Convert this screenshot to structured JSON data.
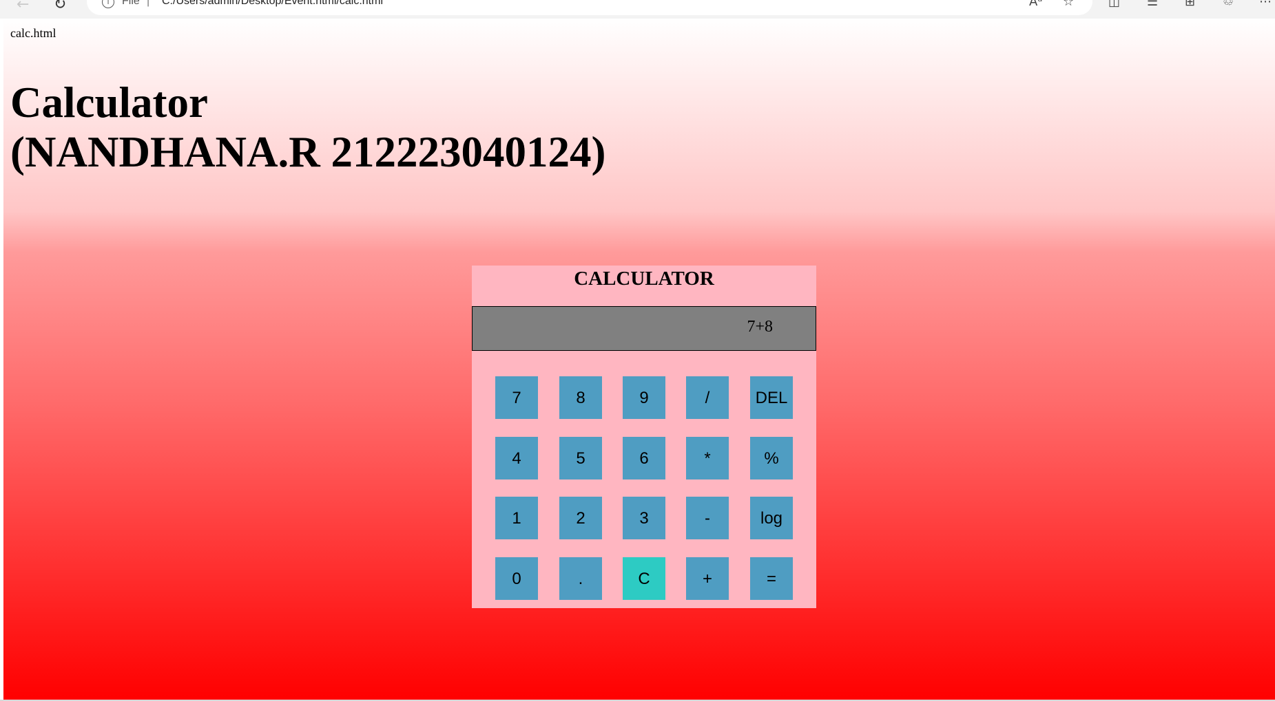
{
  "browser": {
    "back_glyph": "←",
    "reload_glyph": "↻",
    "info_glyph": "i",
    "scheme_label": "File",
    "separator": "|",
    "url": "C:/Users/admin/Desktop/Event.html/calc.html",
    "read_aloud_glyph": "Aᵃ",
    "favorite_glyph": "☆",
    "split_glyph": "◫",
    "favorites_list_glyph": "☰",
    "collections_glyph": "⊞",
    "extensions_glyph": "♲",
    "more_glyph": "⋯",
    "icons": [
      "back-icon",
      "reload-icon",
      "info-icon",
      "read-aloud-icon",
      "favorite-star-icon",
      "split-screen-icon",
      "favorites-icon",
      "collections-icon",
      "browser-essentials-icon",
      "more-icon"
    ]
  },
  "page": {
    "file_label": "calc.html",
    "heading_line1": "Calculator",
    "heading_line2": "(NANDHANA.R 212223040124)",
    "background_top": "#ffffff",
    "background_bottom": "#ff0000"
  },
  "calculator": {
    "title": "CALCULATOR",
    "display_value": "7+8",
    "panel_color": "#ffb6c1",
    "display_color": "#808080",
    "key_color": "#4f9dc2",
    "clear_key_color": "#2dcbc3",
    "rows": [
      [
        "7",
        "8",
        "9",
        "/",
        "DEL"
      ],
      [
        "4",
        "5",
        "6",
        "*",
        "%"
      ],
      [
        "1",
        "2",
        "3",
        "-",
        "log"
      ],
      [
        "0",
        ".",
        "C",
        "+",
        "="
      ]
    ]
  }
}
